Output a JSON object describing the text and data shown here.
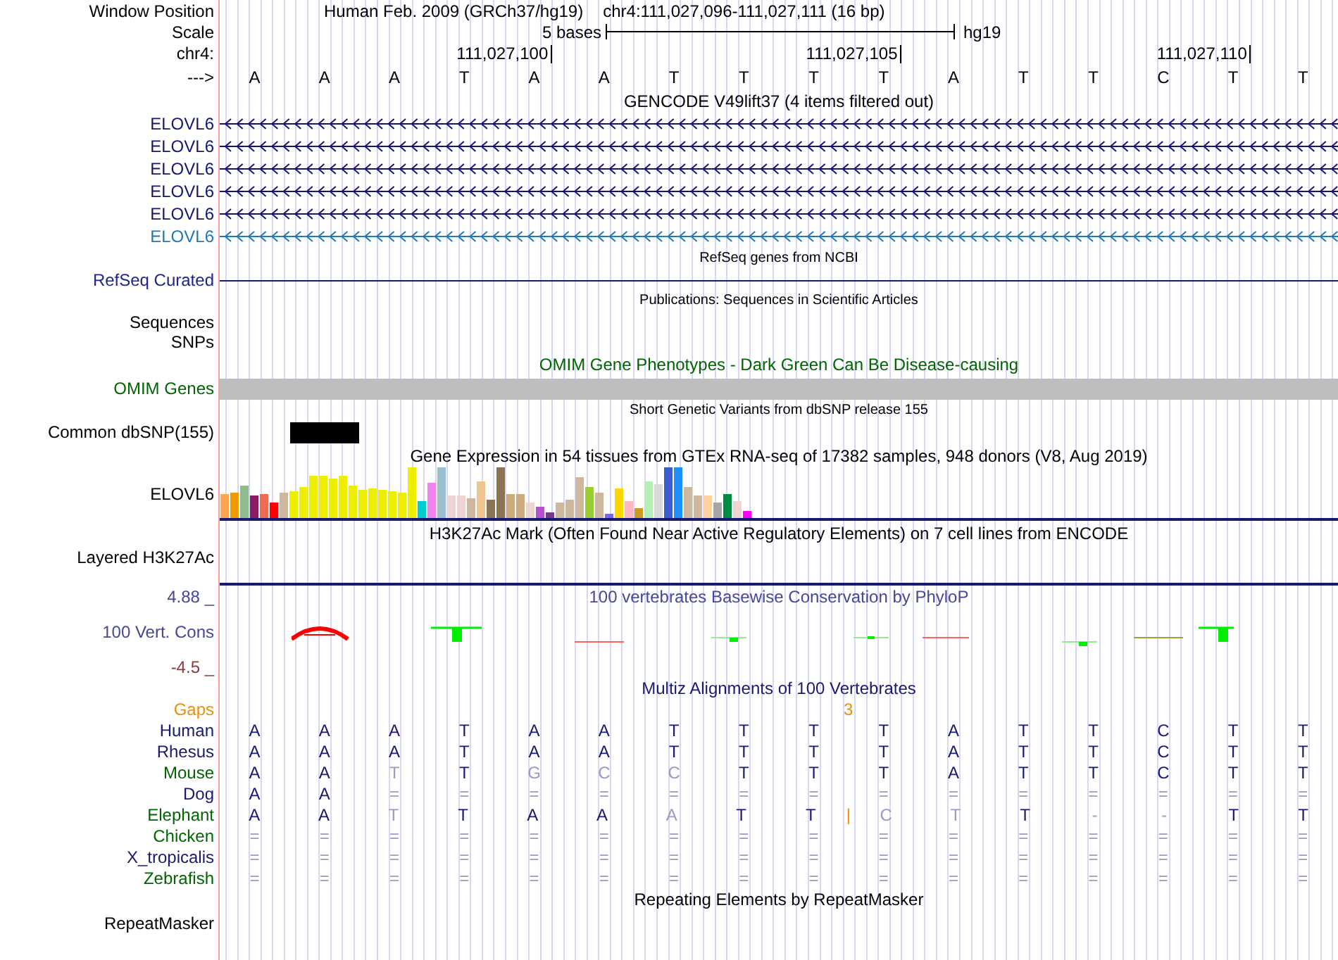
{
  "header": {
    "window_position_label": "Window Position",
    "assembly": "Human Feb. 2009 (GRCh37/hg19)",
    "position": "chr4:111,027,096-111,027,111 (16 bp)",
    "scale_label": "Scale",
    "scale_text": "5 bases",
    "scale_db": "hg19",
    "chrom_label": "chr4:",
    "ruler_ticks": [
      "111,027,100",
      "111,027,105",
      "111,027,110"
    ],
    "strand_label": "--->",
    "bases": [
      "A",
      "A",
      "A",
      "T",
      "A",
      "A",
      "T",
      "T",
      "T",
      "T",
      "A",
      "T",
      "T",
      "C",
      "T",
      "T"
    ]
  },
  "tracks": [
    {
      "kind": "gencode",
      "title": "GENCODE V49lift37 (4 items filtered out)",
      "rows": [
        {
          "label": "ELOVL6",
          "color": "#14147a"
        },
        {
          "label": "ELOVL6",
          "color": "#14147a"
        },
        {
          "label": "ELOVL6",
          "color": "#14147a"
        },
        {
          "label": "ELOVL6",
          "color": "#14147a"
        },
        {
          "label": "ELOVL6",
          "color": "#14147a"
        },
        {
          "label": "ELOVL6",
          "color": "#1f78b8"
        }
      ]
    },
    {
      "kind": "refseq",
      "title": "RefSeq genes from NCBI",
      "label": "RefSeq Curated"
    },
    {
      "kind": "publications",
      "title": "Publications: Sequences in Scientific Articles",
      "labels": [
        "Sequences",
        "SNPs"
      ]
    },
    {
      "kind": "omim",
      "title": "OMIM Gene Phenotypes - Dark Green Can Be Disease-causing",
      "label": "OMIM Genes"
    },
    {
      "kind": "dbsnp",
      "title": "Short Genetic Variants from dbSNP release 155",
      "label": "Common dbSNP(155)"
    },
    {
      "kind": "gtex",
      "title": "Gene Expression in 54 tissues from GTEx RNA-seq of 17382 samples, 948 donors (V8, Aug 2019)",
      "label": "ELOVL6"
    },
    {
      "kind": "h3k27ac",
      "title": "H3K27Ac Mark (Often Found Near Active Regulatory Elements) on 7 cell lines from ENCODE",
      "label": "Layered H3K27Ac"
    },
    {
      "kind": "phylop",
      "title": "100 vertebrates Basewise Conservation by PhyloP",
      "label": "100 Vert. Cons",
      "max_label": "4.88 _",
      "min_label": "-4.5 _"
    },
    {
      "kind": "multiz",
      "title": "Multiz Alignments of 100 Vertebrates",
      "gaps_label": "Gaps",
      "species": [
        {
          "name": "Human",
          "color": "#191970",
          "cells": [
            {
              "base": "A",
              "kind": "match"
            },
            {
              "base": "A",
              "kind": "match"
            },
            {
              "base": "A",
              "kind": "match"
            },
            {
              "base": "T",
              "kind": "match"
            },
            {
              "base": "A",
              "kind": "match"
            },
            {
              "base": "A",
              "kind": "match"
            },
            {
              "base": "T",
              "kind": "match"
            },
            {
              "base": "T",
              "kind": "match"
            },
            {
              "base": "T",
              "kind": "match"
            },
            {
              "base": "T",
              "kind": "match"
            },
            {
              "base": "A",
              "kind": "match"
            },
            {
              "base": "T",
              "kind": "match"
            },
            {
              "base": "T",
              "kind": "match"
            },
            {
              "base": "C",
              "kind": "match"
            },
            {
              "base": "T",
              "kind": "match"
            },
            {
              "base": "T",
              "kind": "match"
            }
          ]
        },
        {
          "name": "Rhesus",
          "color": "#191970",
          "cells": [
            {
              "base": "A",
              "kind": "match"
            },
            {
              "base": "A",
              "kind": "match"
            },
            {
              "base": "A",
              "kind": "match"
            },
            {
              "base": "T",
              "kind": "match"
            },
            {
              "base": "A",
              "kind": "match"
            },
            {
              "base": "A",
              "kind": "match"
            },
            {
              "base": "T",
              "kind": "match"
            },
            {
              "base": "T",
              "kind": "match"
            },
            {
              "base": "T",
              "kind": "match"
            },
            {
              "base": "T",
              "kind": "match"
            },
            {
              "base": "A",
              "kind": "match"
            },
            {
              "base": "T",
              "kind": "match"
            },
            {
              "base": "T",
              "kind": "match"
            },
            {
              "base": "C",
              "kind": "match"
            },
            {
              "base": "T",
              "kind": "match"
            },
            {
              "base": "T",
              "kind": "match"
            }
          ]
        },
        {
          "name": "Mouse",
          "color": "#006400",
          "cells": [
            {
              "base": "A",
              "kind": "match"
            },
            {
              "base": "A",
              "kind": "match"
            },
            {
              "base": "T",
              "kind": "mismatch"
            },
            {
              "base": "T",
              "kind": "match"
            },
            {
              "base": "G",
              "kind": "mismatch"
            },
            {
              "base": "C",
              "kind": "mismatch"
            },
            {
              "base": "C",
              "kind": "mismatch"
            },
            {
              "base": "T",
              "kind": "match"
            },
            {
              "base": "T",
              "kind": "match"
            },
            {
              "base": "T",
              "kind": "match"
            },
            {
              "base": "A",
              "kind": "match"
            },
            {
              "base": "T",
              "kind": "match"
            },
            {
              "base": "T",
              "kind": "match"
            },
            {
              "base": "C",
              "kind": "match"
            },
            {
              "base": "T",
              "kind": "match"
            },
            {
              "base": "T",
              "kind": "match"
            }
          ]
        },
        {
          "name": "Dog",
          "color": "#191970",
          "cells": [
            {
              "base": "A",
              "kind": "match"
            },
            {
              "base": "A",
              "kind": "match"
            },
            {
              "base": "=",
              "kind": "unaligned"
            },
            {
              "base": "=",
              "kind": "unaligned"
            },
            {
              "base": "=",
              "kind": "unaligned"
            },
            {
              "base": "=",
              "kind": "unaligned"
            },
            {
              "base": "=",
              "kind": "unaligned"
            },
            {
              "base": "=",
              "kind": "unaligned"
            },
            {
              "base": "=",
              "kind": "unaligned"
            },
            {
              "base": "=",
              "kind": "unaligned"
            },
            {
              "base": "=",
              "kind": "unaligned"
            },
            {
              "base": "=",
              "kind": "unaligned"
            },
            {
              "base": "=",
              "kind": "unaligned"
            },
            {
              "base": "=",
              "kind": "unaligned"
            },
            {
              "base": "=",
              "kind": "unaligned"
            },
            {
              "base": "=",
              "kind": "unaligned"
            }
          ]
        },
        {
          "name": "Elephant",
          "color": "#006400",
          "cells": [
            {
              "base": "A",
              "kind": "match"
            },
            {
              "base": "A",
              "kind": "match"
            },
            {
              "base": "T",
              "kind": "mismatch"
            },
            {
              "base": "T",
              "kind": "match"
            },
            {
              "base": "A",
              "kind": "match"
            },
            {
              "base": "A",
              "kind": "match"
            },
            {
              "base": "A",
              "kind": "mismatch"
            },
            {
              "base": "T",
              "kind": "match"
            },
            {
              "base": "T",
              "kind": "match"
            },
            {
              "base": "|",
              "kind": "insertion",
              "count": "3"
            },
            {
              "base": "C",
              "kind": "mismatch"
            },
            {
              "base": "T",
              "kind": "mismatch"
            },
            {
              "base": "T",
              "kind": "match"
            },
            {
              "base": "-",
              "kind": "deletion"
            },
            {
              "base": "-",
              "kind": "deletion"
            },
            {
              "base": "T",
              "kind": "match"
            },
            {
              "base": "T",
              "kind": "match"
            }
          ]
        },
        {
          "name": "Chicken",
          "color": "#006400",
          "cells": [
            {
              "base": "=",
              "kind": "unaligned"
            },
            {
              "base": "=",
              "kind": "unaligned"
            },
            {
              "base": "=",
              "kind": "unaligned"
            },
            {
              "base": "=",
              "kind": "unaligned"
            },
            {
              "base": "=",
              "kind": "unaligned"
            },
            {
              "base": "=",
              "kind": "unaligned"
            },
            {
              "base": "=",
              "kind": "unaligned"
            },
            {
              "base": "=",
              "kind": "unaligned"
            },
            {
              "base": "=",
              "kind": "unaligned"
            },
            {
              "base": "=",
              "kind": "unaligned"
            },
            {
              "base": "=",
              "kind": "unaligned"
            },
            {
              "base": "=",
              "kind": "unaligned"
            },
            {
              "base": "=",
              "kind": "unaligned"
            },
            {
              "base": "=",
              "kind": "unaligned"
            },
            {
              "base": "=",
              "kind": "unaligned"
            },
            {
              "base": "=",
              "kind": "unaligned"
            }
          ]
        },
        {
          "name": "X_tropicalis",
          "color": "#191970",
          "cells": [
            {
              "base": "=",
              "kind": "unaligned"
            },
            {
              "base": "=",
              "kind": "unaligned"
            },
            {
              "base": "=",
              "kind": "unaligned"
            },
            {
              "base": "=",
              "kind": "unaligned"
            },
            {
              "base": "=",
              "kind": "unaligned"
            },
            {
              "base": "=",
              "kind": "unaligned"
            },
            {
              "base": "=",
              "kind": "unaligned"
            },
            {
              "base": "=",
              "kind": "unaligned"
            },
            {
              "base": "=",
              "kind": "unaligned"
            },
            {
              "base": "=",
              "kind": "unaligned"
            },
            {
              "base": "=",
              "kind": "unaligned"
            },
            {
              "base": "=",
              "kind": "unaligned"
            },
            {
              "base": "=",
              "kind": "unaligned"
            },
            {
              "base": "=",
              "kind": "unaligned"
            },
            {
              "base": "=",
              "kind": "unaligned"
            },
            {
              "base": "=",
              "kind": "unaligned"
            }
          ]
        },
        {
          "name": "Zebrafish",
          "color": "#006400",
          "cells": [
            {
              "base": "=",
              "kind": "unaligned"
            },
            {
              "base": "=",
              "kind": "unaligned"
            },
            {
              "base": "=",
              "kind": "unaligned"
            },
            {
              "base": "=",
              "kind": "unaligned"
            },
            {
              "base": "=",
              "kind": "unaligned"
            },
            {
              "base": "=",
              "kind": "unaligned"
            },
            {
              "base": "=",
              "kind": "unaligned"
            },
            {
              "base": "=",
              "kind": "unaligned"
            },
            {
              "base": "=",
              "kind": "unaligned"
            },
            {
              "base": "=",
              "kind": "unaligned"
            },
            {
              "base": "=",
              "kind": "unaligned"
            },
            {
              "base": "=",
              "kind": "unaligned"
            },
            {
              "base": "=",
              "kind": "unaligned"
            },
            {
              "base": "=",
              "kind": "unaligned"
            },
            {
              "base": "=",
              "kind": "unaligned"
            },
            {
              "base": "=",
              "kind": "unaligned"
            }
          ]
        }
      ]
    },
    {
      "kind": "repeatmasker",
      "title": "Repeating Elements by RepeatMasker",
      "label": "RepeatMasker"
    }
  ]
}
